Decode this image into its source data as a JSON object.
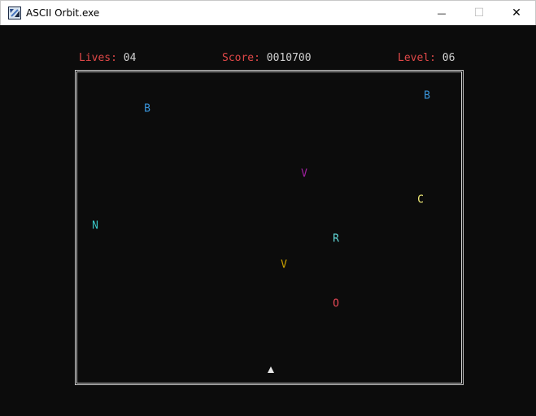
{
  "window": {
    "title": "ASCII Orbit.exe",
    "minimize_glyph": "—",
    "maximize_glyph": "☐",
    "close_glyph": "✕",
    "icon": "app-icon"
  },
  "hud": {
    "lives_label": "Lives:",
    "lives_value": "04",
    "score_label": "Score:",
    "score_value": "0010700",
    "level_label": "Level:",
    "level_value": "06"
  },
  "entities": [
    {
      "glyph": "B",
      "color": "#3a96dd"
    },
    {
      "glyph": "B",
      "color": "#3a96dd"
    },
    {
      "glyph": "V",
      "color": "#a020a0"
    },
    {
      "glyph": "C",
      "color": "#f5f07a"
    },
    {
      "glyph": "N",
      "color": "#3ac8c8"
    },
    {
      "glyph": "R",
      "color": "#61d6d6"
    },
    {
      "glyph": "V",
      "color": "#c8a000"
    },
    {
      "glyph": "O",
      "color": "#e74856"
    }
  ],
  "player": {
    "icon": "player-ship-icon",
    "color": "#e8e8e8"
  },
  "colors": {
    "hud_label": "#e04848",
    "hud_value": "#d0d0d0",
    "background": "#0c0c0c",
    "border": "#c8c8c8"
  }
}
